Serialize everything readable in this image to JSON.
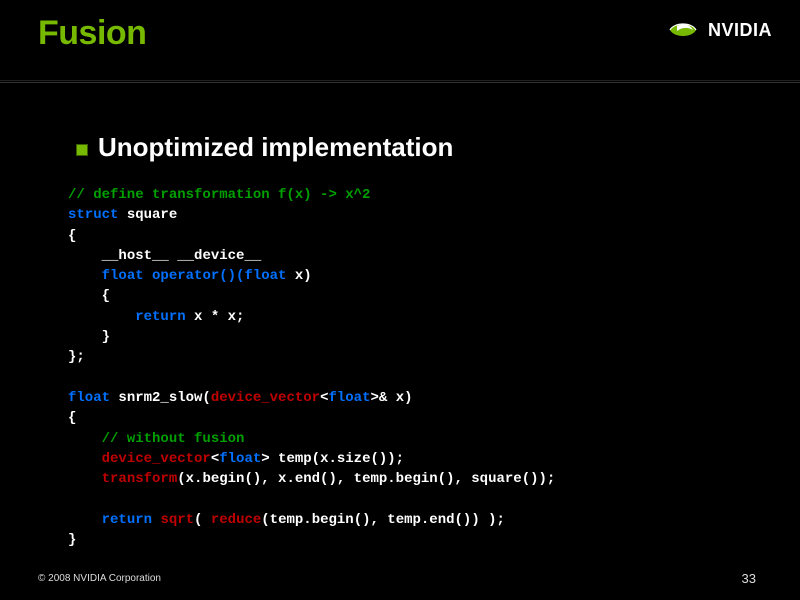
{
  "title": "Fusion",
  "logo": {
    "brand": "NVIDIA",
    "icon_name": "nvidia-eye-icon"
  },
  "bullet": "Unoptimized implementation",
  "code": {
    "c1": "// define transformation f(x) -> x^2",
    "kw_struct": "struct",
    "struct_name": "square",
    "brace_open": "{",
    "host": "__host__",
    "device": "__device__",
    "kw_float1": "float",
    "kw_operator": "operator",
    "paren_float": "()(float",
    "x_decl": " x)",
    "brace_open2": "{",
    "kw_return": "return",
    "ret_expr": " x * x;",
    "brace_close2": "}",
    "struct_end": "};",
    "kw_float2": "float",
    "fn_name": " snrm2_slow(",
    "dvec": "device_vector",
    "tmpl_open": "<",
    "kw_float3": "float",
    "tmpl_close": ">",
    "amp_x": "& x)",
    "brace_open3": "{",
    "c2": "// without fusion",
    "dvec2": "device_vector",
    "kw_float4": "float",
    "temp_decl": " temp(x.size());",
    "transform": "transform",
    "transform_args": "(x.begin(), x.end(), temp.begin(), square());",
    "kw_return2": "return",
    "sqrt": "sqrt",
    "sqrt_open": "( ",
    "reduce": "reduce",
    "reduce_args": "(temp.begin(), temp.end()) );",
    "brace_close3": "}"
  },
  "footer": {
    "copyright": "© 2008 NVIDIA Corporation",
    "page": "33"
  }
}
